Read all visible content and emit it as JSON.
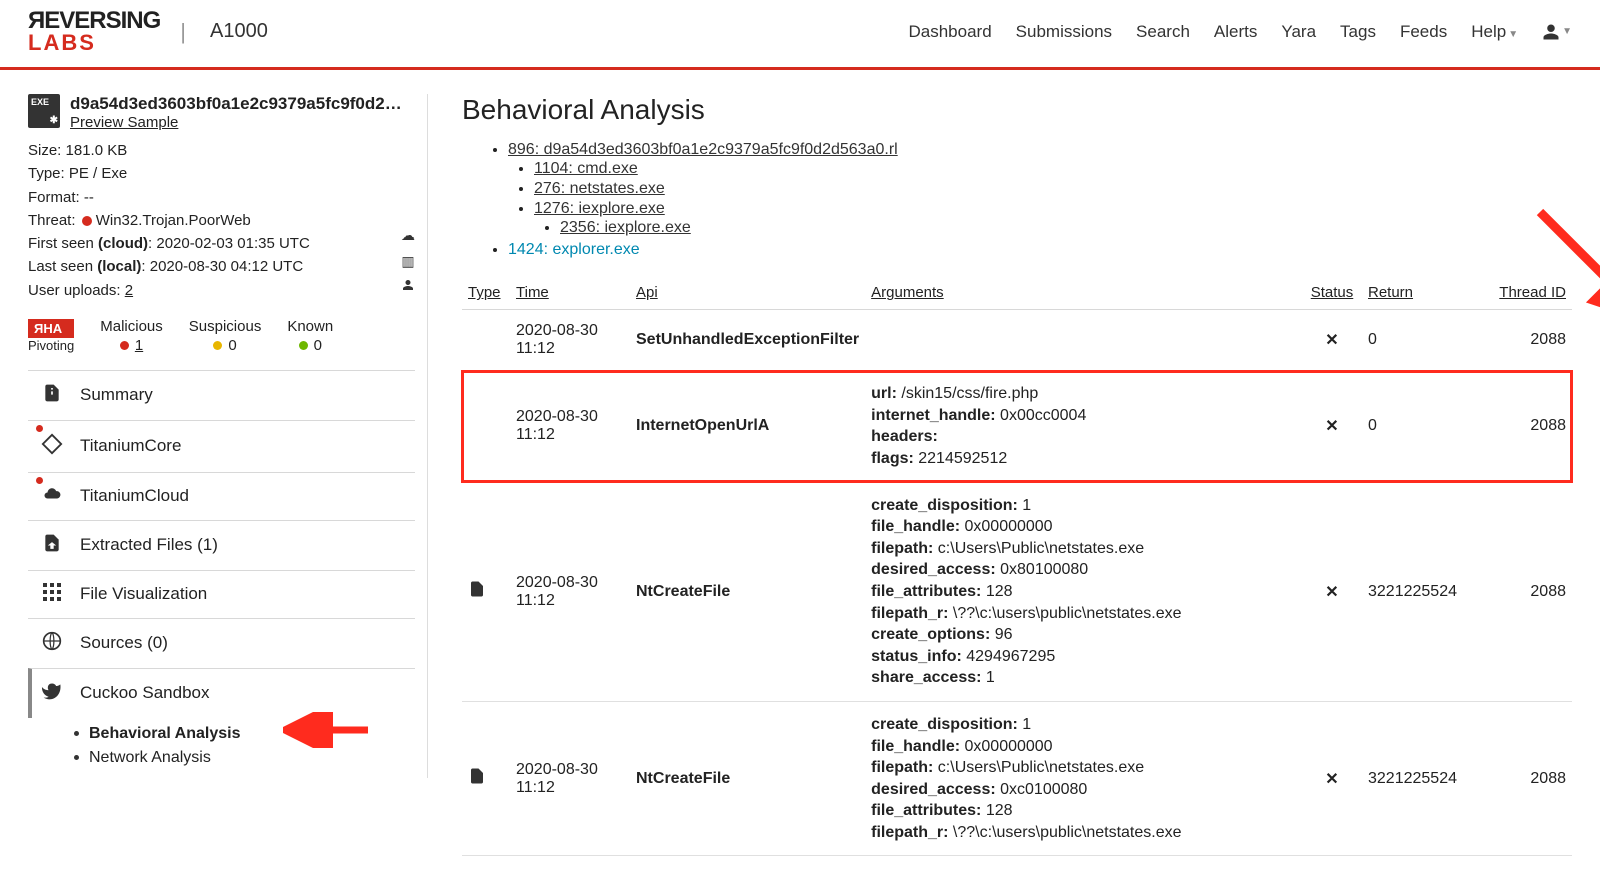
{
  "brand": {
    "name1": "ЯEVERSING",
    "name2": "LABS",
    "product": "A1000"
  },
  "nav": {
    "items": [
      "Dashboard",
      "Submissions",
      "Search",
      "Alerts",
      "Yara",
      "Tags",
      "Feeds",
      "Help"
    ]
  },
  "sample": {
    "hash": "d9a54d3ed3603bf0a1e2c9379a5fc9f0d2d56...",
    "preview_label": "Preview Sample",
    "size_label": "Size:",
    "size_value": "181.0 KB",
    "type_label": "Type:",
    "type_value": "PE / Exe",
    "format_label": "Format:",
    "format_value": "--",
    "threat_label": "Threat:",
    "threat_value": "Win32.Trojan.PoorWeb",
    "first_seen_label": "First seen",
    "first_seen_scope": "(cloud)",
    "first_seen_value": ": 2020-02-03 01:35 UTC",
    "last_seen_label": "Last seen",
    "last_seen_scope": "(local)",
    "last_seen_value": ": 2020-08-30 04:12 UTC",
    "uploads_label": "User uploads:",
    "uploads_value": "2"
  },
  "classification": {
    "rha_label": "ЯHA",
    "pivoting_label": "Pivoting",
    "malicious_label": "Malicious",
    "malicious_value": "1",
    "suspicious_label": "Suspicious",
    "suspicious_value": "0",
    "known_label": "Known",
    "known_value": "0"
  },
  "tabs": {
    "summary": "Summary",
    "tcore": "TitaniumCore",
    "tcloud": "TitaniumCloud",
    "extracted": "Extracted Files (1)",
    "fileviz": "File Visualization",
    "sources": "Sources (0)",
    "cuckoo": "Cuckoo Sandbox",
    "sub_behavioral": "Behavioral Analysis",
    "sub_network": "Network Analysis"
  },
  "page_title": "Behavioral Analysis",
  "process_tree": {
    "root": "896: d9a54d3ed3603bf0a1e2c9379a5fc9f0d2d563a0.rl",
    "children": [
      {
        "label": "1104: cmd.exe"
      },
      {
        "label": "276: netstates.exe"
      },
      {
        "label": "1276: iexplore.exe",
        "children": [
          {
            "label": "2356: iexplore.exe"
          }
        ]
      },
      {
        "label": "-",
        "skip": true
      }
    ],
    "sibling": "1424: explorer.exe"
  },
  "columns": {
    "type": "Type",
    "time": "Time",
    "api": "Api",
    "arguments": "Arguments",
    "status": "Status",
    "return": "Return",
    "thread": "Thread ID"
  },
  "rows": [
    {
      "time": "2020-08-30 11:12",
      "api": "SetUnhandledExceptionFilter",
      "args": [],
      "status": "fail",
      "return": "0",
      "thread": "2088",
      "icon": "",
      "highlight": false
    },
    {
      "time": "2020-08-30 11:12",
      "api": "InternetOpenUrlA",
      "args": [
        {
          "k": "url:",
          "v": " /skin15/css/fire.php"
        },
        {
          "k": "internet_handle:",
          "v": " 0x00cc0004"
        },
        {
          "k": "headers:",
          "v": ""
        },
        {
          "k": "flags:",
          "v": " 2214592512"
        }
      ],
      "status": "fail",
      "return": "0",
      "thread": "2088",
      "icon": "",
      "highlight": true
    },
    {
      "time": "2020-08-30 11:12",
      "api": "NtCreateFile",
      "args": [
        {
          "k": "create_disposition:",
          "v": " 1"
        },
        {
          "k": "file_handle:",
          "v": " 0x00000000"
        },
        {
          "k": "filepath:",
          "v": " c:\\Users\\Public\\netstates.exe"
        },
        {
          "k": "desired_access:",
          "v": " 0x80100080"
        },
        {
          "k": "file_attributes:",
          "v": " 128"
        },
        {
          "k": "filepath_r:",
          "v": " \\??\\c:\\users\\public\\netstates.exe"
        },
        {
          "k": "create_options:",
          "v": " 96"
        },
        {
          "k": "status_info:",
          "v": " 4294967295"
        },
        {
          "k": "share_access:",
          "v": " 1"
        }
      ],
      "status": "fail",
      "return": "3221225524",
      "thread": "2088",
      "icon": "file",
      "highlight": false
    },
    {
      "time": "2020-08-30 11:12",
      "api": "NtCreateFile",
      "args": [
        {
          "k": "create_disposition:",
          "v": " 1"
        },
        {
          "k": "file_handle:",
          "v": " 0x00000000"
        },
        {
          "k": "filepath:",
          "v": " c:\\Users\\Public\\netstates.exe"
        },
        {
          "k": "desired_access:",
          "v": " 0xc0100080"
        },
        {
          "k": "file_attributes:",
          "v": " 128"
        },
        {
          "k": "filepath_r:",
          "v": " \\??\\c:\\users\\public\\netstates.exe"
        }
      ],
      "status": "fail",
      "return": "3221225524",
      "thread": "2088",
      "icon": "file",
      "highlight": false
    }
  ]
}
